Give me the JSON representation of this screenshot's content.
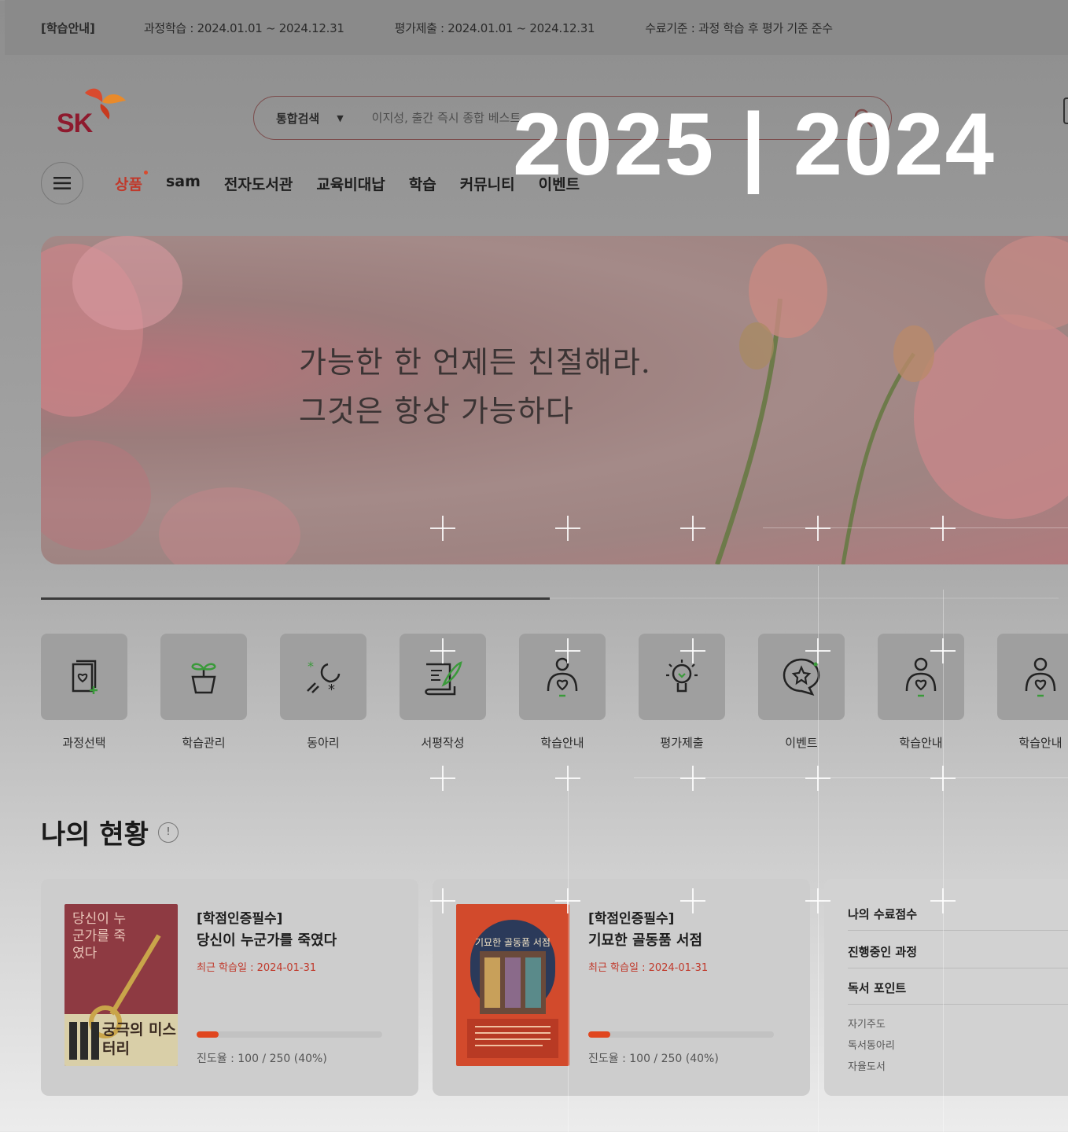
{
  "notice": {
    "label": "[학습안내]",
    "course": "과정학습 : 2024.01.01 ~ 2024.12.31",
    "evaluation": "평가제출 : 2024.01.01 ~ 2024.12.31",
    "criteria": "수료기준 : 과정 학습 후 평가 기준 준수"
  },
  "header": {
    "logo_text": "SK",
    "search_scope": "통합검색",
    "search_placeholder": "이지성, 출간 즉시 종합 베스트",
    "overlay_title": "2025 | 2024"
  },
  "nav": {
    "items": [
      "상품",
      "sam",
      "전자도서관",
      "교육비대납",
      "학습",
      "커뮤니티",
      "이벤트"
    ]
  },
  "banner": {
    "line1": "가능한 한 언제든 친절해라.",
    "line2": "그것은 항상 가능하다"
  },
  "banner_progress": 0.5,
  "quick_menu": [
    {
      "label": "과정선택",
      "icon": "book-heart-icon"
    },
    {
      "label": "학습관리",
      "icon": "sprout-pot-icon"
    },
    {
      "label": "동아리",
      "icon": "moon-stars-icon"
    },
    {
      "label": "서평작성",
      "icon": "scroll-quill-icon"
    },
    {
      "label": "학습안내",
      "icon": "person-heart-icon"
    },
    {
      "label": "평가제출",
      "icon": "lightbulb-icon"
    },
    {
      "label": "이벤트",
      "icon": "star-chat-icon"
    },
    {
      "label": "학습안내",
      "icon": "person-heart-icon"
    },
    {
      "label": "학습안내",
      "icon": "person-heart-icon"
    }
  ],
  "status": {
    "title": "나의 현황",
    "info": "!",
    "cards": [
      {
        "tag": "[학점인증필수]",
        "title": "당신이 누군가를 죽였다",
        "date": "최근 학습일 : 2024-01-31",
        "progress_text": "진도율 : 100 / 250 (40%)",
        "progress": 0.4,
        "cover_title": "당신이 누군가를 죽였다",
        "cover_series": "궁극의 미스터리"
      },
      {
        "tag": "[학점인증필수]",
        "title": "기묘한 골동품 서점",
        "date": "최근 학습일 : 2024-01-31",
        "progress_text": "진도율 : 100 / 250 (40%)",
        "progress": 0.4,
        "cover_title": "기묘한 골동품 서점"
      }
    ],
    "summary": {
      "score": "나의 수료점수",
      "ongoing": "진행중인 과정",
      "points": "독서 포인트",
      "sub_items": [
        "자기주도",
        "독서동아리",
        "자율도서"
      ]
    }
  },
  "colors": {
    "accent": "#e0461f",
    "brand_red": "#c0392b"
  }
}
